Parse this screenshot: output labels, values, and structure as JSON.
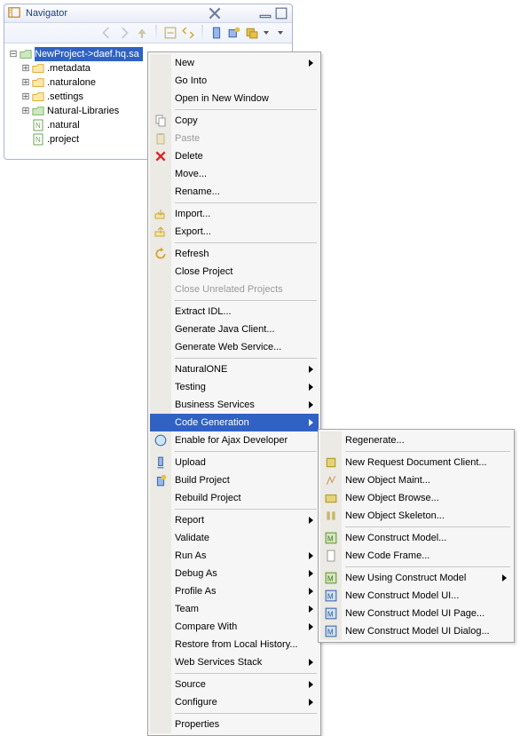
{
  "navigator": {
    "title": "Navigator",
    "tree": {
      "root": {
        "label": "NewProject->daef.hq.sa"
      },
      "metadata": ".metadata",
      "naturalone": ".naturalone",
      "settings": ".settings",
      "natlib": "Natural-Libraries",
      "natural": ".natural",
      "project": ".project"
    }
  },
  "menu": {
    "new": "New",
    "go_into": "Go Into",
    "open_window": "Open in New Window",
    "copy": "Copy",
    "paste": "Paste",
    "delete": "Delete",
    "move": "Move...",
    "rename": "Rename...",
    "import": "Import...",
    "export": "Export...",
    "refresh": "Refresh",
    "close_project": "Close Project",
    "close_unrelated": "Close Unrelated Projects",
    "extract_idl": "Extract IDL...",
    "gen_java": "Generate Java Client...",
    "gen_ws": "Generate Web Service...",
    "naturalone": "NaturalONE",
    "testing": "Testing",
    "business_services": "Business Services",
    "code_generation": "Code Generation",
    "enable_ajax": "Enable for Ajax Developer",
    "upload": "Upload",
    "build_project": "Build Project",
    "rebuild_project": "Rebuild Project",
    "report": "Report",
    "validate": "Validate",
    "run_as": "Run As",
    "debug_as": "Debug As",
    "profile_as": "Profile As",
    "team": "Team",
    "compare_with": "Compare With",
    "restore_history": "Restore from Local History...",
    "web_service_stack": "Web Services Stack",
    "source": "Source",
    "configure": "Configure",
    "properties": "Properties"
  },
  "submenu": {
    "regenerate": "Regenerate...",
    "req_doc_client": "New Request Document Client...",
    "obj_maint": "New Object Maint...",
    "obj_browse": "New Object Browse...",
    "obj_skeleton": "New Object Skeleton...",
    "construct_model": "New Construct Model...",
    "code_frame": "New Code Frame...",
    "using_construct": "New Using Construct Model",
    "construct_ui": "New Construct Model UI...",
    "construct_ui_page": "New Construct Model UI Page...",
    "construct_ui_dialog": "New Construct Model UI Dialog..."
  }
}
